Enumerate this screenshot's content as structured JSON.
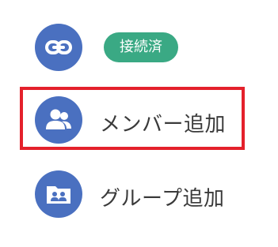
{
  "connection": {
    "icon": "link-icon",
    "status_label": "接続済"
  },
  "menu": {
    "add_member": {
      "icon": "people-icon",
      "label": "メンバー追加",
      "highlighted": true
    },
    "add_group": {
      "icon": "group-folder-icon",
      "label": "グループ追加"
    }
  },
  "colors": {
    "icon_background": "#4a70c0",
    "status_badge": "#3aa984",
    "highlight_border": "#e4212b",
    "label_text": "#3a3a3a"
  }
}
